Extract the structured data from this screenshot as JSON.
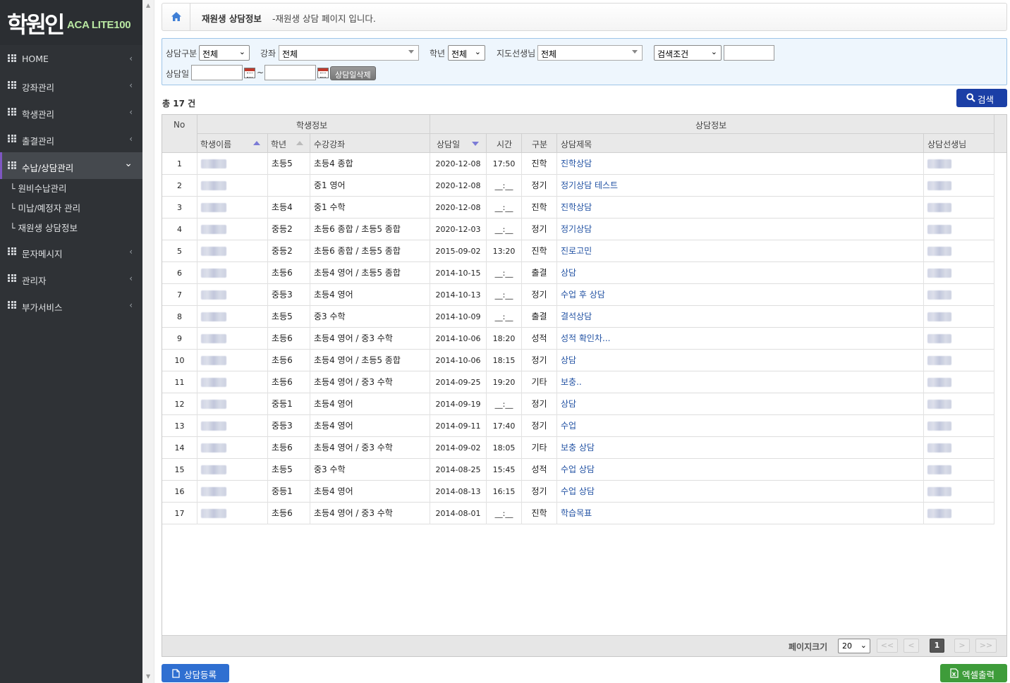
{
  "app": {
    "logo_main": "학원인",
    "logo_sub": "ACA LITE100"
  },
  "sidebar": {
    "items": [
      {
        "label": "HOME"
      },
      {
        "label": "강좌관리"
      },
      {
        "label": "학생관리"
      },
      {
        "label": "출결관리"
      },
      {
        "label": "수납/상담관리"
      },
      {
        "label": "문자메시지"
      },
      {
        "label": "관리자"
      },
      {
        "label": "부가서비스"
      }
    ],
    "subitems": [
      {
        "label": "└ 원비수납관리"
      },
      {
        "label": "└ 미납/예정자 관리"
      },
      {
        "label": "└ 재원생 상담정보"
      }
    ]
  },
  "breadcrumb": {
    "title": "재원생 상담정보",
    "desc": "-재원생 상담 페이지 입니다."
  },
  "search": {
    "type_label": "상담구분",
    "type_value": "전체",
    "course_label": "강좌",
    "course_value": "전체",
    "grade_label": "학년",
    "grade_value": "전체",
    "teacher_label": "지도선생님",
    "teacher_value": "전체",
    "cond_value": "검색조건",
    "cond_text": "",
    "date_label": "상담일",
    "date_from": "",
    "date_to": "",
    "tilde": "~",
    "date_delete": "상담일삭제",
    "search_button": "검색"
  },
  "total": "총 17 건",
  "grid": {
    "group_student": "학생정보",
    "group_consult": "상담정보",
    "columns": {
      "no": "No",
      "name": "학생이름",
      "grade": "학년",
      "course": "수강강좌",
      "date": "상담일",
      "time": "시간",
      "type": "구분",
      "title": "상담제목",
      "teacher": "상담선생님"
    },
    "rows": [
      {
        "no": "1",
        "grade": "초등5",
        "course": "초등4 종합",
        "date": "2020-12-08",
        "time": "17:50",
        "type": "진학",
        "title": "진학상담"
      },
      {
        "no": "2",
        "grade": "",
        "course": "중1 영어",
        "date": "2020-12-08",
        "time": "__:__",
        "type": "정기",
        "title": "정기상담 테스트"
      },
      {
        "no": "3",
        "grade": "초등4",
        "course": "중1 수학",
        "date": "2020-12-08",
        "time": "__:__",
        "type": "진학",
        "title": "진학상담"
      },
      {
        "no": "4",
        "grade": "중등2",
        "course": "초등6 종합 / 초등5 종합",
        "date": "2020-12-03",
        "time": "__:__",
        "type": "정기",
        "title": "정기상담"
      },
      {
        "no": "5",
        "grade": "중등2",
        "course": "초등6 종합 / 초등5 종합",
        "date": "2015-09-02",
        "time": "13:20",
        "type": "진학",
        "title": "진로고민"
      },
      {
        "no": "6",
        "grade": "초등6",
        "course": "초등4 영어 / 초등5 종합",
        "date": "2014-10-15",
        "time": "__:__",
        "type": "출결",
        "title": "상담"
      },
      {
        "no": "7",
        "grade": "중등3",
        "course": "초등4 영어",
        "date": "2014-10-13",
        "time": "__:__",
        "type": "정기",
        "title": "수업 후 상담"
      },
      {
        "no": "8",
        "grade": "초등5",
        "course": "중3 수학",
        "date": "2014-10-09",
        "time": "__:__",
        "type": "출결",
        "title": "결석상담"
      },
      {
        "no": "9",
        "grade": "초등6",
        "course": "초등4 영어 / 중3 수학",
        "date": "2014-10-06",
        "time": "18:20",
        "type": "성적",
        "title": "성적 확인차..."
      },
      {
        "no": "10",
        "grade": "초등6",
        "course": "초등4 영어 / 초등5 종합",
        "date": "2014-10-06",
        "time": "18:15",
        "type": "정기",
        "title": "상담"
      },
      {
        "no": "11",
        "grade": "초등6",
        "course": "초등4 영어 / 중3 수학",
        "date": "2014-09-25",
        "time": "19:20",
        "type": "기타",
        "title": "보충.."
      },
      {
        "no": "12",
        "grade": "중등1",
        "course": "초등4 영어",
        "date": "2014-09-19",
        "time": "__:__",
        "type": "정기",
        "title": "상담"
      },
      {
        "no": "13",
        "grade": "중등3",
        "course": "초등4 영어",
        "date": "2014-09-11",
        "time": "17:40",
        "type": "정기",
        "title": "수업"
      },
      {
        "no": "14",
        "grade": "초등6",
        "course": "초등4 영어 / 중3 수학",
        "date": "2014-09-02",
        "time": "18:05",
        "type": "기타",
        "title": "보충 상담"
      },
      {
        "no": "15",
        "grade": "초등5",
        "course": "중3 수학",
        "date": "2014-08-25",
        "time": "15:45",
        "type": "성적",
        "title": "수업 상담"
      },
      {
        "no": "16",
        "grade": "중등1",
        "course": "초등4 영어",
        "date": "2014-08-13",
        "time": "16:15",
        "type": "정기",
        "title": "수업 상담"
      },
      {
        "no": "17",
        "grade": "초등6",
        "course": "초등4 영어 / 중3 수학",
        "date": "2014-08-01",
        "time": "__:__",
        "type": "진학",
        "title": "학습목표"
      }
    ]
  },
  "pager": {
    "size_label": "페이지크기",
    "size_value": "20",
    "first": "<<",
    "prev": "<",
    "current": "1",
    "next": ">",
    "last": ">>"
  },
  "buttons": {
    "register": "상담등록",
    "excel": "엑셀출력"
  },
  "colors": {
    "sidebar_bg": "#2f3236",
    "active_accent": "#7e57c2",
    "search_btn": "#1b3fa6",
    "register_btn": "#2f6fd1",
    "excel_btn": "#3e9c3a",
    "link": "#2252a3"
  },
  "icons": {
    "home": "home-icon",
    "grid": "grid-icon",
    "search": "search-icon",
    "calendar": "calendar-icon",
    "document": "document-icon",
    "excel": "excel-icon"
  }
}
